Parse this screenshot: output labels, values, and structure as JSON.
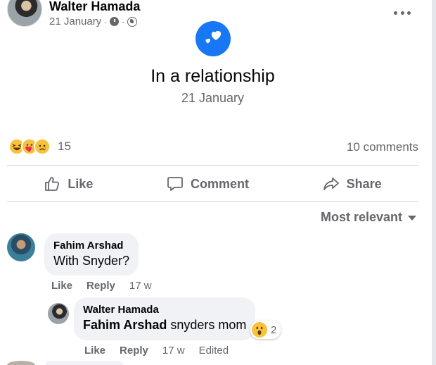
{
  "post": {
    "author": "Walter Hamada",
    "date": "21 January",
    "separator": "·"
  },
  "life_event": {
    "title": "In a relationship",
    "date": "21 January"
  },
  "reactions": {
    "count": "15",
    "emojis": [
      "haha",
      "love",
      "sad"
    ]
  },
  "comments_count": "10 comments",
  "actions": {
    "like": "Like",
    "comment": "Comment",
    "share": "Share"
  },
  "sort_label": "Most relevant",
  "comments": [
    {
      "author": "Fahim Arshad",
      "text": "With Snyder?",
      "like": "Like",
      "reply": "Reply",
      "time": "17 w"
    }
  ],
  "reply": {
    "author": "Walter Hamada",
    "mention": "Fahim Arshad",
    "text": " snyders mom",
    "reaction_count": "2",
    "like": "Like",
    "reply": "Reply",
    "time": "17 w",
    "edited": "Edited"
  },
  "colors": {
    "accent": "#1877f2",
    "secondary_text": "#65676b",
    "bubble": "#f0f2f5"
  }
}
